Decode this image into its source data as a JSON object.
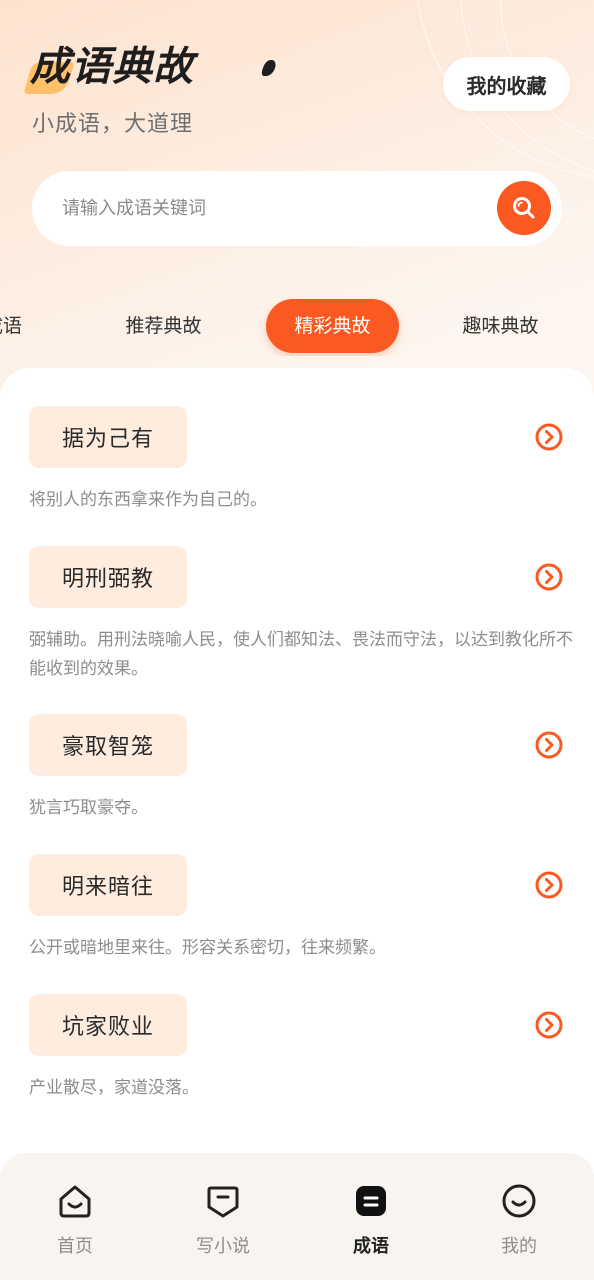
{
  "header": {
    "title": "成语典故",
    "subtitle": "小成语，大道理",
    "favorites_label": "我的收藏"
  },
  "search": {
    "placeholder": "请输入成语关键词",
    "icon": "search-icon"
  },
  "tabs": [
    {
      "label": "成语"
    },
    {
      "label": "推荐典故"
    },
    {
      "label": "精彩典故",
      "active": true
    },
    {
      "label": "趣味典故"
    }
  ],
  "idioms": [
    {
      "name": "据为己有",
      "desc": "将别人的东西拿来作为自己的。"
    },
    {
      "name": "明刑弼教",
      "desc": "弼辅助。用刑法晓喻人民，使人们都知法、畏法而守法，以达到教化所不能收到的效果。"
    },
    {
      "name": "豪取智笼",
      "desc": "犹言巧取豪夺。"
    },
    {
      "name": "明来暗往",
      "desc": "公开或暗地里来往。形容关系密切，往来频繁。"
    },
    {
      "name": "坑家败业",
      "desc": "产业散尽，家道没落。"
    }
  ],
  "bottom_nav": [
    {
      "label": "首页",
      "icon": "home-icon"
    },
    {
      "label": "写小说",
      "icon": "write-icon"
    },
    {
      "label": "成语",
      "icon": "idiom-icon",
      "active": true
    },
    {
      "label": "我的",
      "icon": "profile-icon"
    }
  ],
  "colors": {
    "accent": "#fa5a22",
    "chip_bg": "#feeddf",
    "title_highlight": "#ffc06a"
  }
}
